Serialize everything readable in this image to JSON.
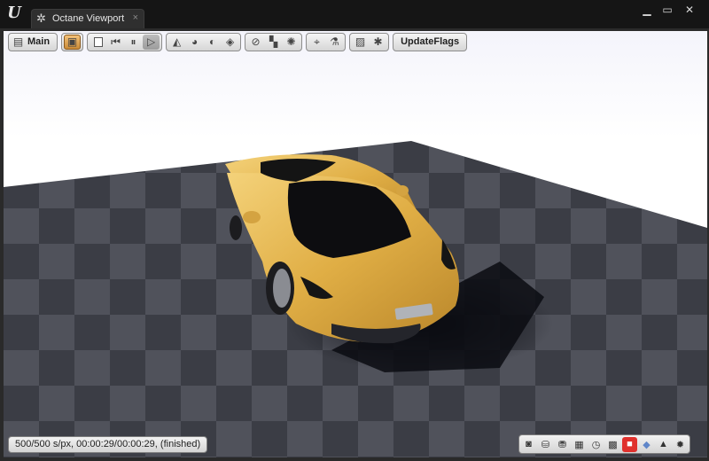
{
  "window": {
    "tab_title": "Octane Viewport",
    "tab_icon": "gear-icon",
    "close_glyph": "×",
    "controls": {
      "minimize": "▁",
      "maximize": "▭",
      "close": "✕"
    }
  },
  "toolbar": {
    "main_label": "Main",
    "update_flags_label": "UpdateFlags"
  },
  "status": {
    "render_text": "500/500 s/px, 00:00:29/00:00:29, (finished)"
  },
  "colors": {
    "accent_active": "#d89a45",
    "car_body": "#e2b24a",
    "floor_dark": "#3f424a",
    "floor_light": "#575a63",
    "record_red": "#e0312d"
  },
  "bottom_icons": [
    "camera-icon",
    "disk-save-icon",
    "disk-export-icon",
    "render-region-icon",
    "clock-icon",
    "film-icon",
    "stop-icon",
    "cube-icon",
    "image-icon",
    "sun-icon"
  ]
}
